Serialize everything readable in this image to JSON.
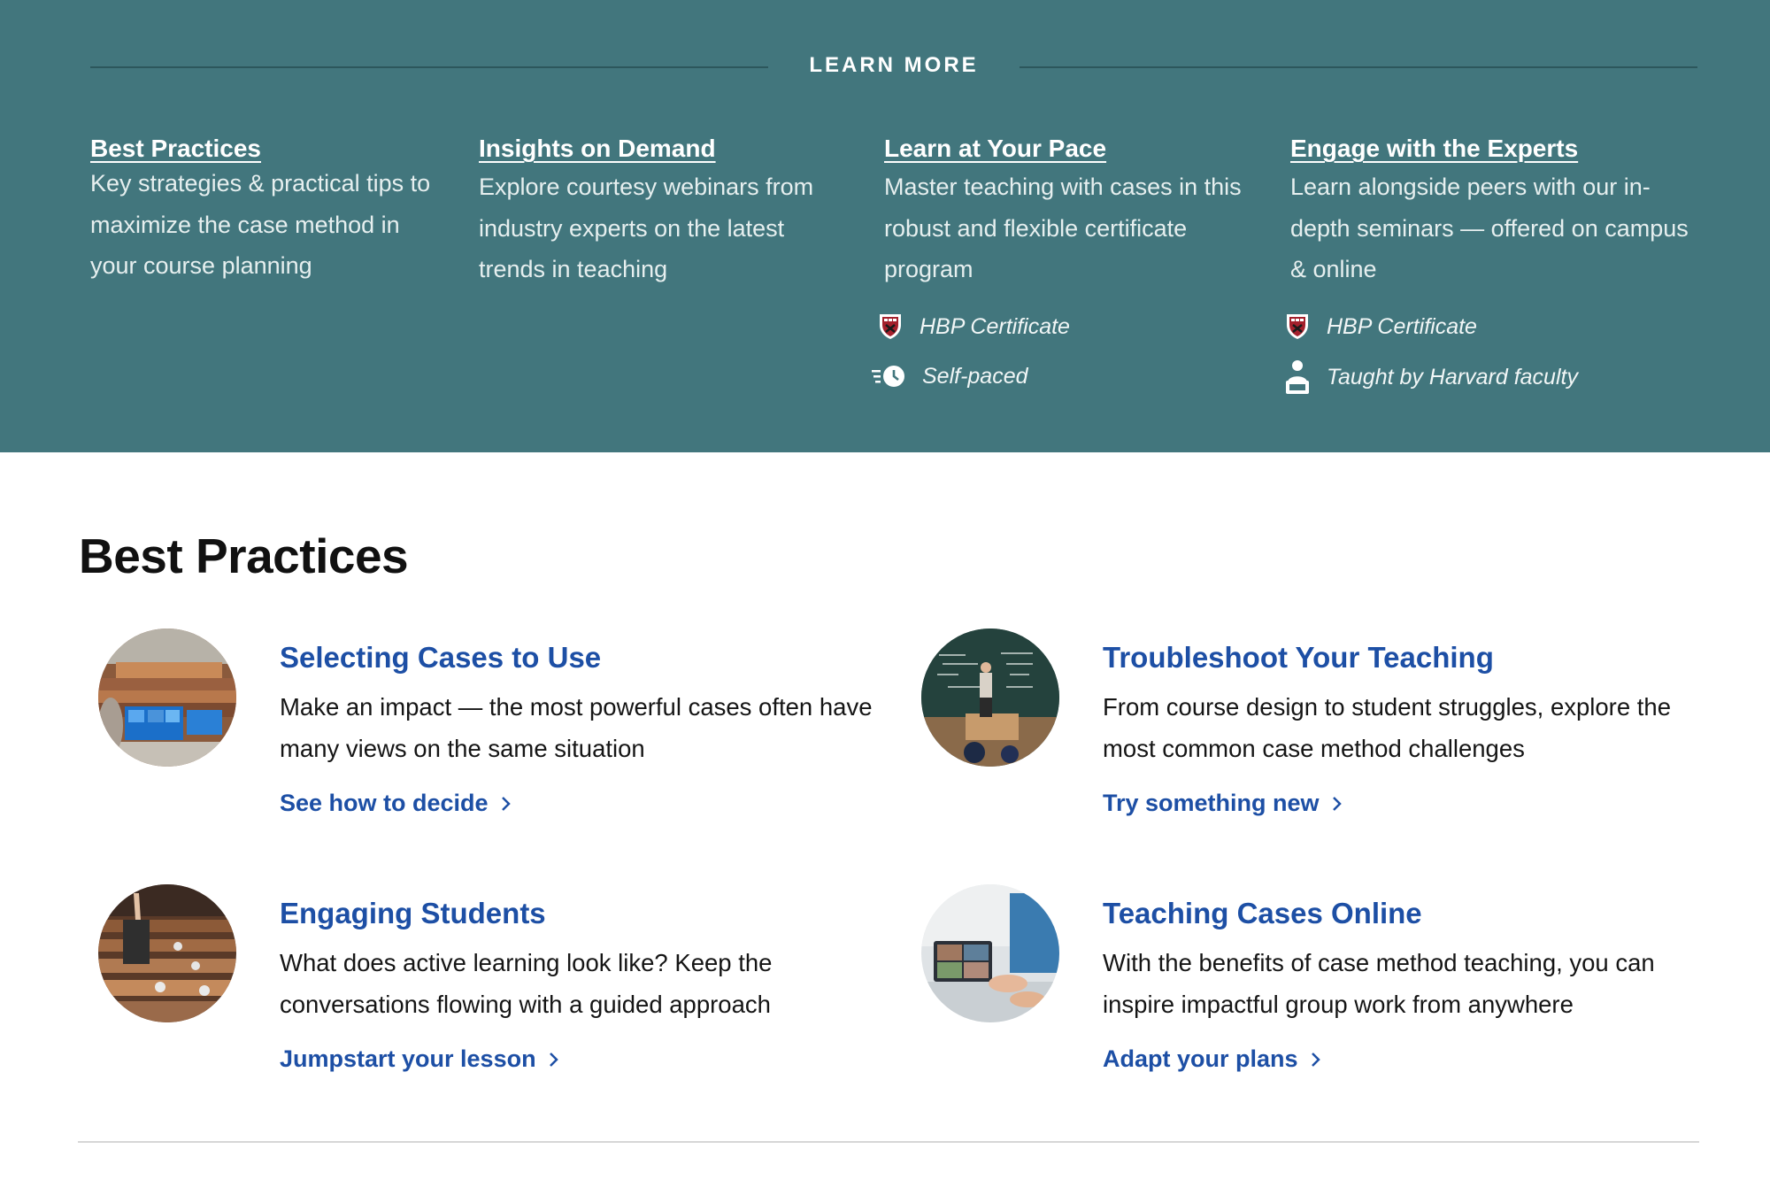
{
  "learn_more": {
    "heading": "LEARN MORE",
    "columns": [
      {
        "title": "Best Practices",
        "description": "Key strategies & practical tips to maximize the case method in your course planning"
      },
      {
        "title": "Insights on Demand",
        "description": "Explore courtesy webinars from industry experts on the latest trends in teaching"
      },
      {
        "title": "Learn at Your Pace",
        "description": "Master teaching with cases in this robust and flexible certificate program",
        "meta": [
          {
            "icon": "hbp-shield-icon",
            "label": "HBP Certificate"
          },
          {
            "icon": "self-paced-clock-icon",
            "label": "Self-paced"
          }
        ]
      },
      {
        "title": "Engage with the Experts",
        "description": "Learn alongside peers with our in-depth seminars — offered on campus & online",
        "meta": [
          {
            "icon": "hbp-shield-icon",
            "label": "HBP Certificate"
          },
          {
            "icon": "instructor-icon",
            "label": "Taught by Harvard faculty"
          }
        ]
      }
    ],
    "colors": {
      "band": "#42767d",
      "rule": "#2c575c",
      "text": "#ffffff"
    }
  },
  "best_practices": {
    "title": "Best Practices",
    "cards": [
      {
        "title": "Selecting Cases to Use",
        "description": "Make an impact — the most powerful cases often have many views on the same situation",
        "link": "See how to decide",
        "image": "lecture-hall-photo"
      },
      {
        "title": "Troubleshoot Your Teaching",
        "description": "From course design to student struggles, explore the most common case method challenges",
        "link": "Try something new",
        "image": "chalkboard-teacher-photo"
      },
      {
        "title": "Engaging Students",
        "description": "What does active learning look like? Keep the conversations flowing with a guided approach",
        "link": "Jumpstart your lesson",
        "image": "raised-hand-classroom-photo"
      },
      {
        "title": "Teaching Cases Online",
        "description": "With the benefits of case method teaching, you can inspire impactful group work from anywhere",
        "link": "Adapt your plans",
        "image": "video-call-laptop-photo"
      }
    ],
    "colors": {
      "link": "#1d4fa5",
      "text": "#151515"
    }
  }
}
